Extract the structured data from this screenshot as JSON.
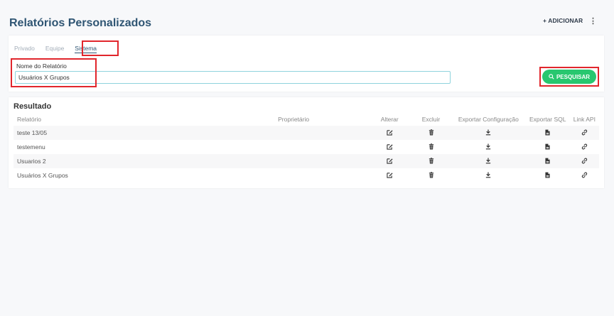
{
  "header": {
    "title": "Relatórios Personalizados",
    "add_label": "+ ADICIONAR",
    "more_icon": "more-vertical-icon"
  },
  "filter": {
    "tabs": [
      {
        "label": "Privado"
      },
      {
        "label": "Equipe"
      },
      {
        "label": "Sistema"
      }
    ],
    "active_tab": "Sistema",
    "name_label": "Nome do Relatório",
    "name_value": "Usuários X Grupos",
    "search_label": "PESQUISAR",
    "search_color": "#28c76f",
    "highlight_color": "#e1262c"
  },
  "result": {
    "title": "Resultado",
    "columns": {
      "report": "Relatório",
      "owner": "Proprietário",
      "edit": "Alterar",
      "delete": "Excluir",
      "export_config": "Exportar Configuração",
      "export_sql": "Exportar SQL",
      "link_api": "Link API"
    },
    "rows": [
      {
        "report": "teste 13/05",
        "owner": ""
      },
      {
        "report": "testemenu",
        "owner": ""
      },
      {
        "report": "Usuarios 2",
        "owner": ""
      },
      {
        "report": "Usuários X Grupos",
        "owner": ""
      }
    ],
    "row_icons": [
      "edit-icon",
      "trash-icon",
      "download-icon",
      "file-icon",
      "link-icon"
    ]
  }
}
